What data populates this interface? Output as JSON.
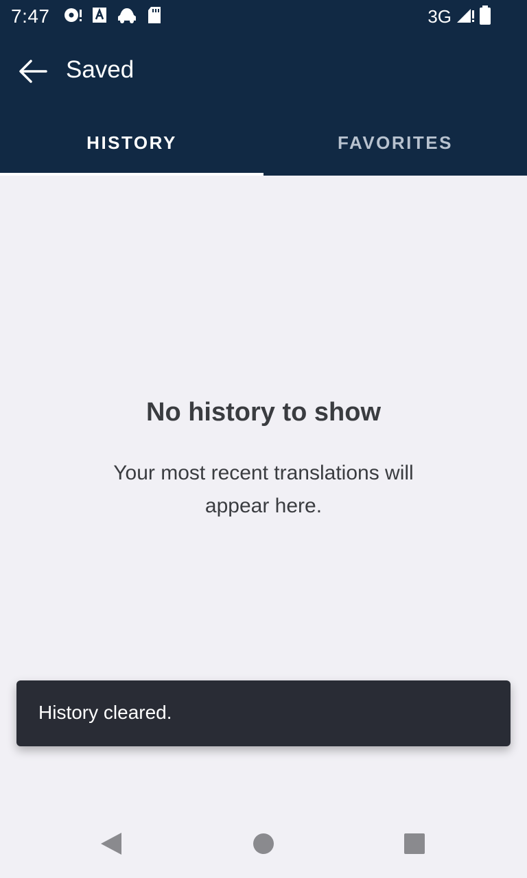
{
  "status_bar": {
    "time": "7:47",
    "network": "3G",
    "left_icons": [
      "speaker-alert-icon",
      "text-a-icon",
      "car-icon",
      "sd-card-icon"
    ],
    "right_icons": [
      "signal-icon",
      "battery-icon"
    ]
  },
  "app_bar": {
    "title": "Saved",
    "back_icon": "arrow-back-icon"
  },
  "tabs": [
    {
      "label": "HISTORY",
      "selected": true
    },
    {
      "label": "FAVORITES",
      "selected": false
    }
  ],
  "empty_state": {
    "title": "No history to show",
    "subtitle": "Your most recent translations will appear here."
  },
  "snackbar": {
    "message": "History cleared."
  },
  "nav_bar": {
    "icons": [
      "back-triangle-icon",
      "home-circle-icon",
      "recents-square-icon"
    ]
  },
  "colors": {
    "app_bar": "#112944",
    "background": "#f1f0f5",
    "snackbar": "#292c35",
    "text_dark": "#3a3c40",
    "tab_inactive": "#b8c2cf"
  }
}
